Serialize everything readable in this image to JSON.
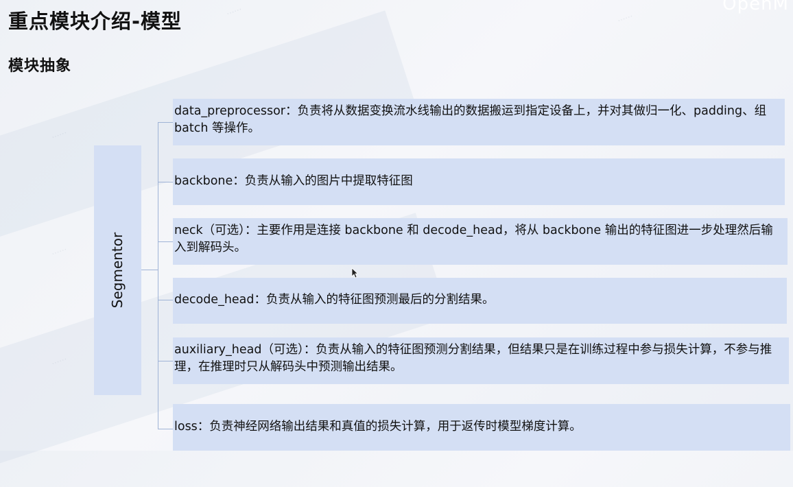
{
  "brand": "OpenM",
  "page_title": "重点模块介绍-模型",
  "section_title": "模块抽象",
  "root_label": "Segmentor",
  "modules": [
    {
      "text": "data_preprocessor：负责将从数据变换流水线输出的数据搬运到指定设备上，并对其做归一化、padding、组 batch 等操作。"
    },
    {
      "text": "backbone：负责从输入的图片中提取特征图"
    },
    {
      "text": "neck（可选）：主要作用是连接 backbone 和 decode_head，将从 backbone 输出的特征图进一步处理然后输入到解码头。"
    },
    {
      "text": "decode_head：负责从输入的特征图预测最后的分割结果。"
    },
    {
      "text": "auxiliary_head（可选）：负责从输入的特征图预测分割结果，但结果只是在训练过程中参与损失计算，不参与推理，在推理时只从解码头中预测输出结果。"
    },
    {
      "text": "loss：负责神经网络输出结果和真值的损失计算，用于返传时模型梯度计算。"
    }
  ],
  "colors": {
    "box": "#d4dff4",
    "line": "#9fb3d6"
  }
}
